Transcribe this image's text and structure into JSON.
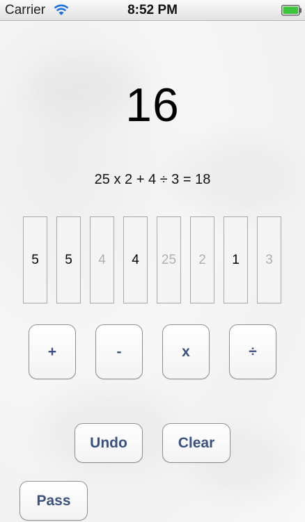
{
  "status_bar": {
    "carrier": "Carrier",
    "time": "8:52 PM",
    "wifi_icon": "wifi-icon",
    "battery_icon": "battery-icon",
    "battery_color": "#3cc43c"
  },
  "game": {
    "target": "16",
    "equation": "25 x 2 + 4 ÷ 3 = 18",
    "tiles": [
      {
        "value": "5",
        "used": false
      },
      {
        "value": "5",
        "used": false
      },
      {
        "value": "4",
        "used": true
      },
      {
        "value": "4",
        "used": false
      },
      {
        "value": "25",
        "used": true
      },
      {
        "value": "2",
        "used": true
      },
      {
        "value": "1",
        "used": false
      },
      {
        "value": "3",
        "used": true
      }
    ],
    "operators": [
      "+",
      "-",
      "x",
      "÷"
    ],
    "undo_label": "Undo",
    "clear_label": "Clear",
    "pass_label": "Pass",
    "button_text_color": "#3b5180"
  }
}
